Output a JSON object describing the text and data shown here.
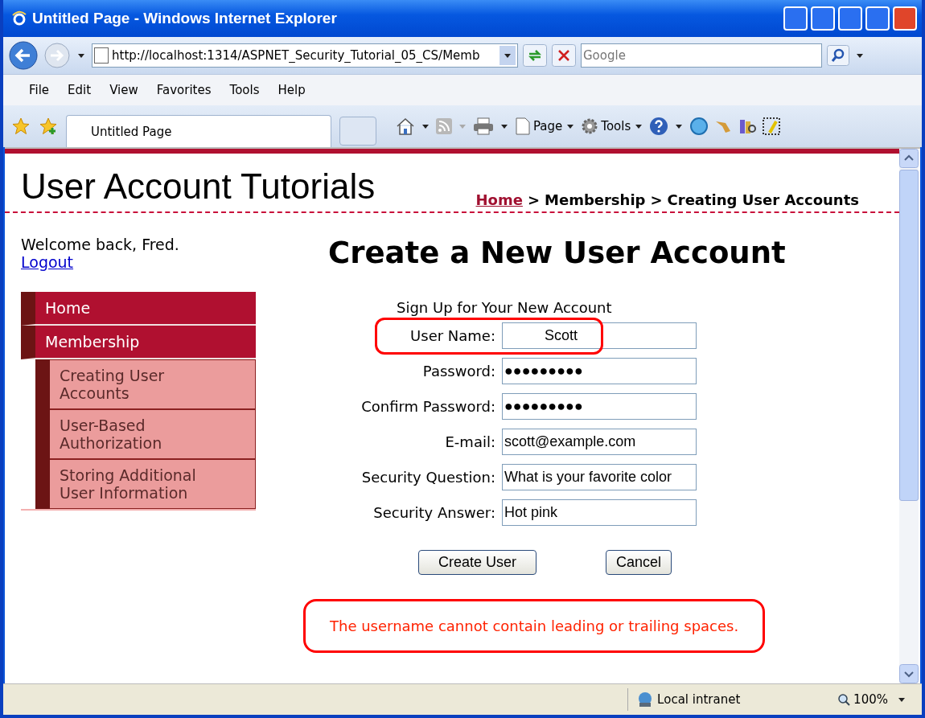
{
  "window": {
    "title": "Untitled Page - Windows Internet Explorer"
  },
  "address_bar": {
    "url": "http://localhost:1314/ASPNET_Security_Tutorial_05_CS/Memb"
  },
  "search": {
    "placeholder": "Google"
  },
  "menu_bar": [
    "File",
    "Edit",
    "View",
    "Favorites",
    "Tools",
    "Help"
  ],
  "tabs": [
    {
      "label": "Untitled Page",
      "selected": true
    }
  ],
  "command_bar": [
    "Page",
    "Tools"
  ],
  "page": {
    "site_title": "User Account Tutorials",
    "breadcrumb": {
      "link": "Home",
      "rest": [
        "Membership",
        "Creating User Accounts"
      ],
      "separator": ">"
    },
    "welcome": "Welcome back, Fred.",
    "logout": "Logout",
    "nav": [
      {
        "label": "Home"
      },
      {
        "label": "Membership",
        "children": [
          {
            "label": "Creating User Accounts"
          },
          {
            "label": "User-Based Authorization"
          },
          {
            "label": "Storing Additional User Information"
          }
        ]
      }
    ],
    "heading": "Create a New User Account",
    "form_title": "Sign Up for Your New Account",
    "fields": [
      {
        "label": "User Name:",
        "value": "          Scott",
        "highlighted": true
      },
      {
        "label": "Password:",
        "value": "●●●●●●●●●",
        "highlighted": false
      },
      {
        "label": "Confirm Password:",
        "value": "●●●●●●●●●",
        "highlighted": false
      },
      {
        "label": "E-mail:",
        "value": "scott@example.com",
        "highlighted": false
      },
      {
        "label": "Security Question:",
        "value": "What is your favorite color",
        "highlighted": false
      },
      {
        "label": "Security Answer:",
        "value": "Hot pink",
        "highlighted": false
      }
    ],
    "buttons": [
      "Create User",
      "Cancel"
    ],
    "error": "The username cannot contain leading or trailing spaces."
  },
  "status_bar": {
    "zone": "Local intranet",
    "zoom": "100%"
  }
}
